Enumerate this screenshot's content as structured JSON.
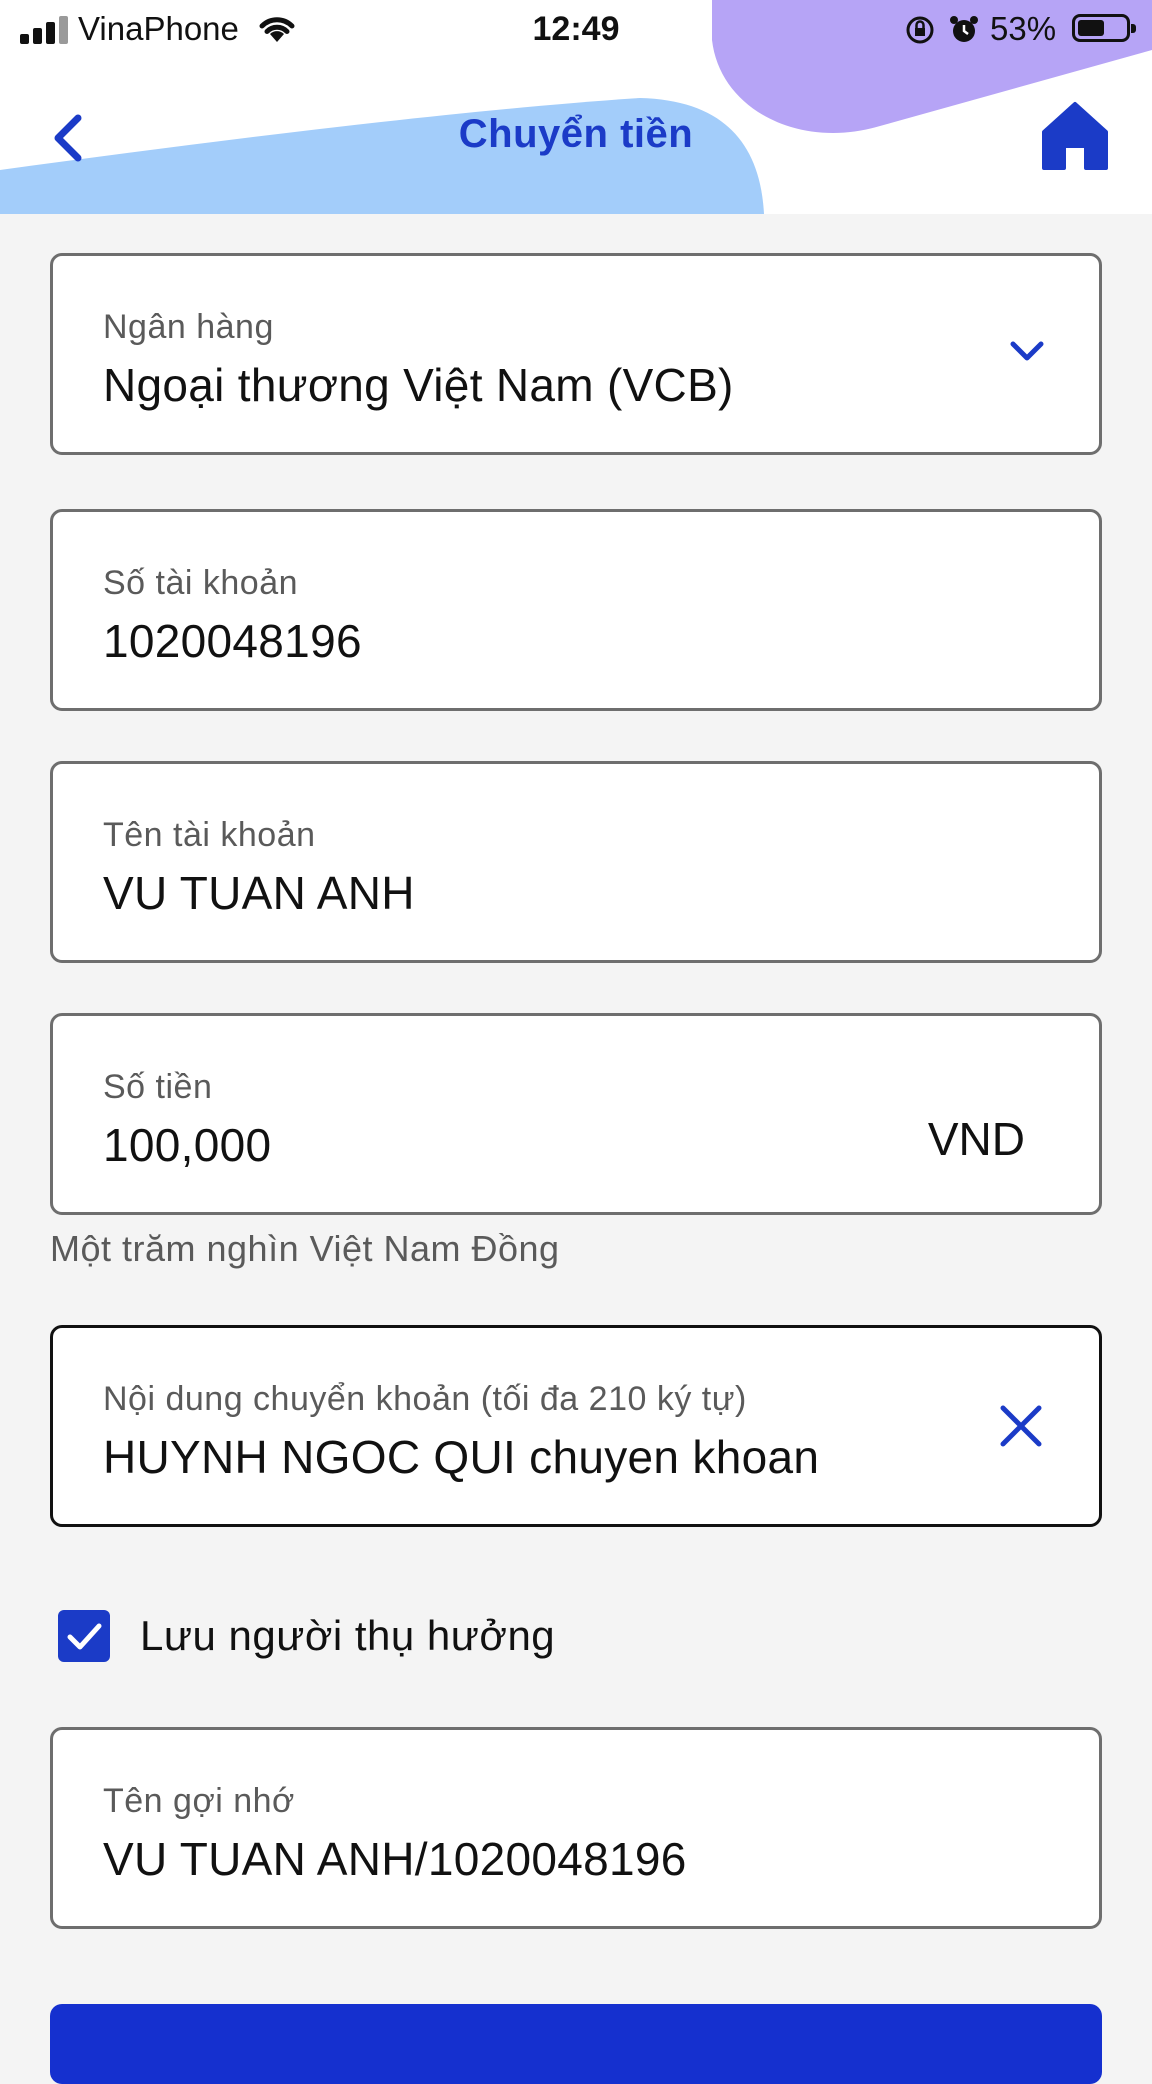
{
  "status_bar": {
    "carrier": "VinaPhone",
    "time": "12:49",
    "battery": "53%"
  },
  "header": {
    "title": "Chuyển tiền",
    "back_icon": "chevron-left-icon",
    "home_icon": "home-icon",
    "accent_color": "#1b3bc7"
  },
  "form": {
    "bank": {
      "label": "Ngân hàng",
      "value": "Ngoại thương Việt Nam (VCB)"
    },
    "account_number": {
      "label": "Số tài khoản",
      "value": "1020048196"
    },
    "account_name": {
      "label": "Tên tài khoản",
      "value": "VU TUAN ANH"
    },
    "amount": {
      "label": "Số tiền",
      "value": "100,000",
      "currency": "VND",
      "in_words": "Một trăm nghìn Việt Nam Đồng"
    },
    "content": {
      "label": "Nội dung chuyển khoản (tối đa 210 ký tự)",
      "value": "HUYNH NGOC QUI chuyen khoan"
    },
    "save_beneficiary": {
      "label": "Lưu người thụ hưởng",
      "checked": true
    },
    "nickname": {
      "label": "Tên gợi nhớ",
      "value": "VU TUAN ANH/1020048196"
    }
  }
}
